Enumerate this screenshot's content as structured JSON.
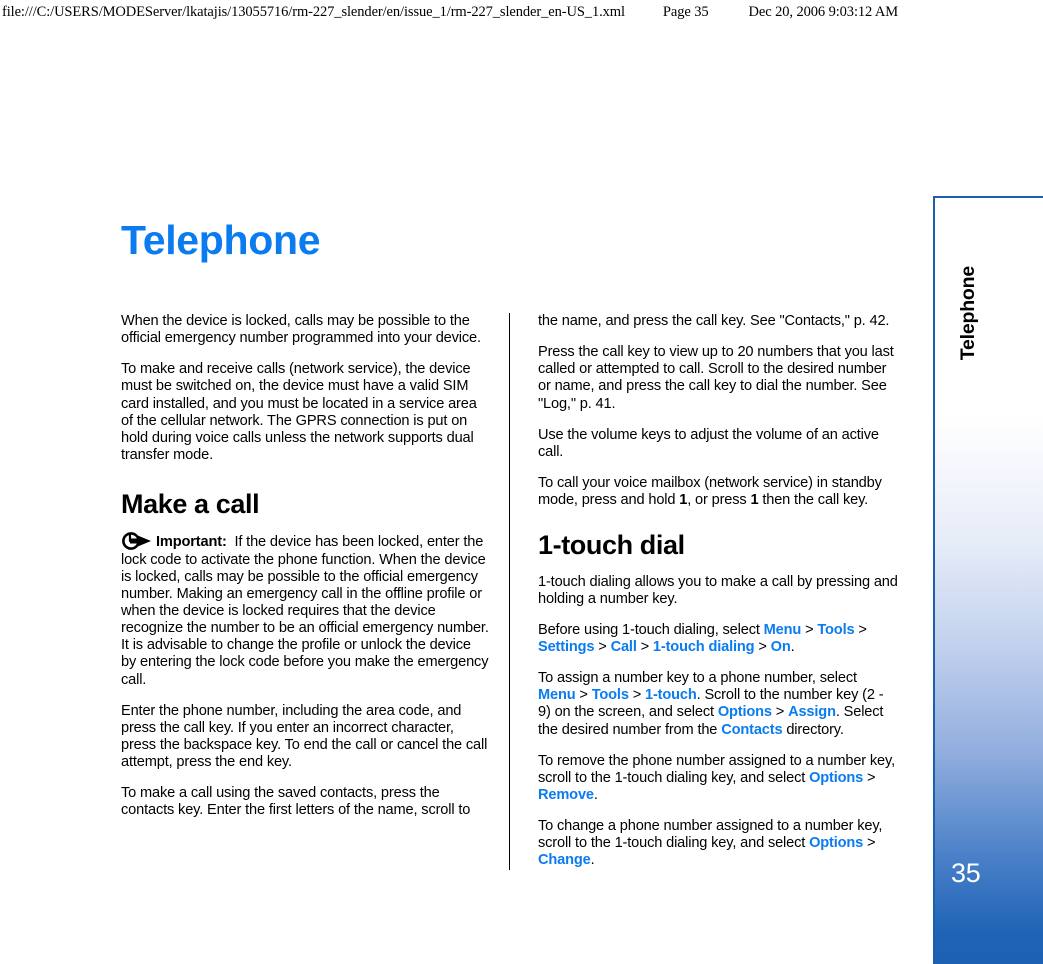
{
  "print_header": {
    "url": "file:///C:/USERS/MODEServer/lkatajis/13055716/rm-227_slender/en/issue_1/rm-227_slender_en-US_1.xml",
    "page_label": "Page 35",
    "timestamp": "Dec 20, 2006 9:03:12 AM"
  },
  "document": {
    "title": "Telephone",
    "accent_color": "#0a7cf0",
    "sidebar": {
      "tab_label": "Telephone",
      "page_number": "35",
      "border_color": "#1b5fae",
      "gradient_end_color": "#1d61b3"
    }
  },
  "left_column": {
    "p1": "When the device is locked, calls may be possible to the official emergency number programmed into your device.",
    "p2": "To make and receive calls (network service), the device must be switched on, the device must have a valid SIM card installed, and you must be located in a service area of the cellular network. The GPRS connection is put on hold during voice calls unless the network supports dual transfer mode.",
    "heading_make_a_call": "Make a call",
    "important_icon_name": "important-arrow-icon",
    "important_label": "Important:",
    "important_text": "If the device has been locked, enter the lock code to activate the phone function. When the device is locked, calls may be possible to the official emergency number. Making an emergency call in the offline profile or when the device is locked requires that the device recognize the number to be an official emergency number. It is advisable to change the profile or unlock the device by entering the lock code before you make the emergency call.",
    "p3": "Enter the phone number, including the area code, and press the call key. If you enter an incorrect character, press the backspace key. To end the call or cancel the call attempt, press the end key.",
    "p4": "To make a call using the saved contacts, press the contacts key. Enter the first letters of the name, scroll to"
  },
  "right_column": {
    "p1": "the name, and press the call key. See \"Contacts,\" p. 42.",
    "p2": "Press the call key to view up to 20 numbers that you last called or attempted to call. Scroll to the desired number or name, and press the call key to dial the number. See \"Log,\" p. 41.",
    "p3": "Use the volume keys to adjust the volume of an active call.",
    "p4_a": "To call your voice mailbox (network service) in standby mode, press and hold ",
    "p4_key1": "1",
    "p4_b": ", or press ",
    "p4_key2": "1",
    "p4_c": " then the call key.",
    "heading_one_touch_dial": "1-touch dial",
    "p5": "1-touch dialing allows you to make a call by pressing and holding a number key.",
    "p6_a": "Before using 1-touch dialing, select ",
    "p6_terms": [
      "Menu",
      "Tools",
      "Settings",
      "Call",
      "1-touch dialing",
      "On"
    ],
    "p6_end": ".",
    "p7_a": "To assign a number key to a phone number, select ",
    "p7_terms1": [
      "Menu",
      "Tools",
      "1-touch"
    ],
    "p7_b": ". Scroll to the number key (2 - 9) on the screen, and select ",
    "p7_terms2": [
      "Options",
      "Assign"
    ],
    "p7_c": ". Select the desired number from the ",
    "p7_term3": "Contacts",
    "p7_d": " directory.",
    "p8_a": "To remove the phone number assigned to a number key, scroll to the 1-touch dialing key, and select ",
    "p8_terms": [
      "Options",
      "Remove"
    ],
    "p8_end": ".",
    "p9_a": "To change a phone number assigned to a number key, scroll to the 1-touch dialing key, and select ",
    "p9_terms": [
      "Options",
      "Change"
    ],
    "p9_end": ".",
    "separator": " > "
  }
}
